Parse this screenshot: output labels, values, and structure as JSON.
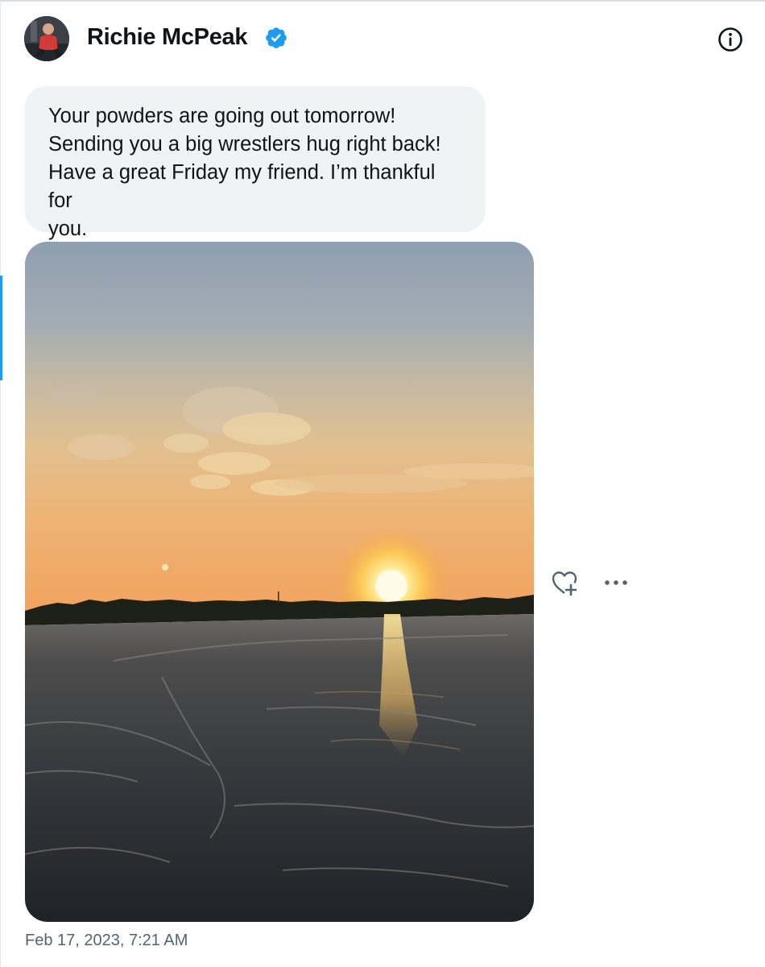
{
  "conversation": {
    "name": "Richie McPeak",
    "verified": true
  },
  "message": {
    "text": "Your powders are going out tomorrow!\nSending you a big wrestlers hug right back!\nHave a great Friday my friend. I’m thankful for\nyou.",
    "timestamp": "Feb 17, 2023, 7:21 AM"
  },
  "colors": {
    "accent": "#1d9bf0",
    "bubble": "#eff3f4",
    "muted_text": "#536471"
  },
  "icons": {
    "info": "info-icon",
    "react": "heart-plus-icon",
    "more": "more-horizontal-icon",
    "verified": "verified-badge-icon"
  }
}
